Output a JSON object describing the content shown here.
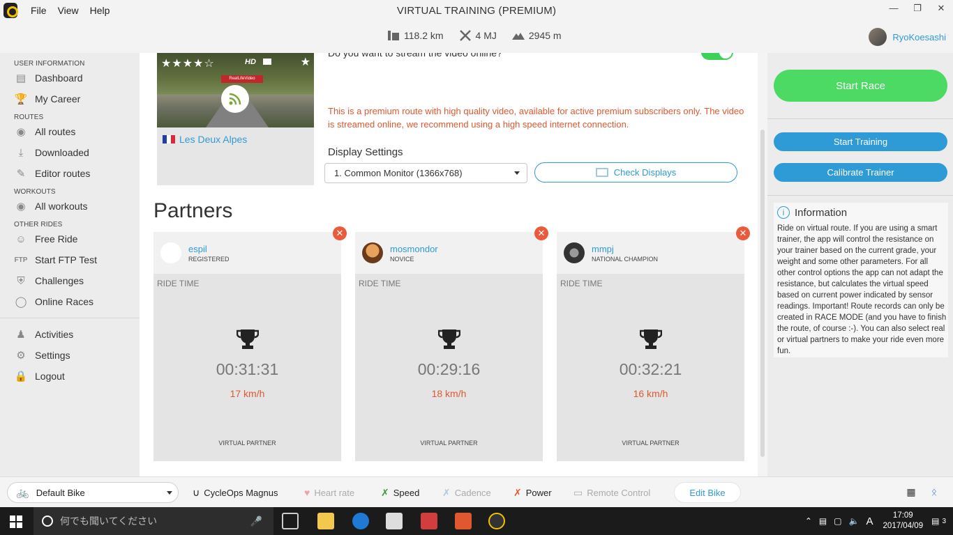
{
  "window": {
    "title": "VIRTUAL TRAINING (PREMIUM)",
    "menu": [
      "File",
      "View",
      "Help"
    ]
  },
  "stats": {
    "distance": "118.2 km",
    "energy": "4 MJ",
    "elevation": "2945 m"
  },
  "user": {
    "name": "RyoKoesashi"
  },
  "sidebar": {
    "sections": [
      {
        "title": "USER INFORMATION",
        "items": [
          {
            "label": "Dashboard",
            "icon": "dashboard-icon"
          },
          {
            "label": "My Career",
            "icon": "trophy-icon"
          }
        ]
      },
      {
        "title": "ROUTES",
        "items": [
          {
            "label": "All routes",
            "icon": "eye-icon"
          },
          {
            "label": "Downloaded",
            "icon": "download-icon"
          },
          {
            "label": "Editor routes",
            "icon": "edit-icon"
          }
        ]
      },
      {
        "title": "WORKOUTS",
        "items": [
          {
            "label": "All workouts",
            "icon": "eye-icon"
          }
        ]
      },
      {
        "title": "OTHER RIDES",
        "items": [
          {
            "label": "Free Ride",
            "icon": "smile-icon"
          },
          {
            "label": "Start FTP Test",
            "icon": "ftp-icon"
          },
          {
            "label": "Challenges",
            "icon": "badge-icon"
          },
          {
            "label": "Online Races",
            "icon": "globe-icon"
          }
        ]
      }
    ],
    "bottom_items": [
      {
        "label": "Activities",
        "icon": "people-icon"
      },
      {
        "label": "Settings",
        "icon": "gear-icon"
      },
      {
        "label": "Logout",
        "icon": "lock-icon"
      }
    ],
    "ftp_prefix": "FTP"
  },
  "route": {
    "name": "Les Deux Alpes",
    "rating_stars": "★★★★☆",
    "hd_label": "HD",
    "banner": "RealLifeVideo"
  },
  "stream": {
    "question": "Do you want to stream the video online?",
    "enabled": true,
    "premium_note": "This is a premium route with high quality video, available for active premium subscribers only. The video is streamed online, we recommend using a high speed internet connection."
  },
  "display": {
    "title": "Display Settings",
    "selected": "1. Common Monitor (1366x768)",
    "check_label": "Check Displays"
  },
  "partners": {
    "title": "Partners",
    "ride_time_label": "RIDE TIME",
    "virtual_label": "VIRTUAL PARTNER",
    "items": [
      {
        "name": "espil",
        "level": "REGISTERED",
        "time": "00:31:31",
        "speed": "17 km/h"
      },
      {
        "name": "mosmondor",
        "level": "NOVICE",
        "time": "00:29:16",
        "speed": "18 km/h"
      },
      {
        "name": "mmpj",
        "level": "NATIONAL CHAMPION",
        "time": "00:32:21",
        "speed": "16 km/h"
      }
    ]
  },
  "actions": {
    "start_race": "Start Race",
    "start_training": "Start Training",
    "calibrate": "Calibrate Trainer"
  },
  "info": {
    "title": "Information",
    "text": "Ride on virtual route. If you are using a smart trainer, the app will control the resistance on your trainer based on the current grade, your weight and some other parameters. For all other control options the app can not adapt the resistance, but calculates the virtual speed based on current power indicated by sensor readings. Important! Route records can only be created in RACE MODE (and you have to finish the route, of course :-). You can also select real or virtual partners to  make your ride even more fun."
  },
  "bottom": {
    "bike": "Default Bike",
    "trainer": "CycleOps Magnus",
    "heart_rate": "Heart rate",
    "speed": "Speed",
    "cadence": "Cadence",
    "power": "Power",
    "remote": "Remote Control",
    "edit_bike": "Edit Bike"
  },
  "taskbar": {
    "search_placeholder": "何でも聞いてください",
    "time": "17:09",
    "date": "2017/04/09",
    "ime": "A",
    "notifications": "3"
  },
  "colors": {
    "accent_blue": "#2e9bd6",
    "green": "#4cd964",
    "warning": "#e0582f"
  }
}
